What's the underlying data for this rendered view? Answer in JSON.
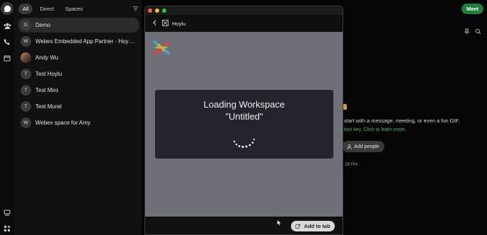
{
  "list": {
    "tabs": [
      {
        "label": "All",
        "active": true
      },
      {
        "label": "Direct",
        "active": false
      },
      {
        "label": "Spaces",
        "active": false
      }
    ],
    "conversations": [
      {
        "initial": "D",
        "label": "Demo",
        "active": true
      },
      {
        "initial": "W",
        "label": "Webex Embedded App Partner - Hoylu...",
        "active": false
      },
      {
        "initial": "",
        "label": "Andy Wu",
        "active": false,
        "photo": true
      },
      {
        "initial": "T",
        "label": "Test Hoylu",
        "active": false
      },
      {
        "initial": "T",
        "label": "Test Miro",
        "active": false
      },
      {
        "initial": "T",
        "label": "Test Mural",
        "active": false
      },
      {
        "initial": "W",
        "label": "Webex space for Amy",
        "active": false
      }
    ]
  },
  "main": {
    "meet_label": "Meet",
    "message": "start with a message, meeting, or even a fun GIF.",
    "link": "tion key. Click to learn more.",
    "add_people_label": "Add people",
    "time": ":26 PM"
  },
  "popup": {
    "title": "Hoylu",
    "loading_title": "Loading Workspace",
    "loading_name": "\"Untitled\"",
    "add_to_tab_label": "Add to tab"
  },
  "colors": {
    "canvas": "#6f6f78",
    "meet": "#1e7f3a",
    "link": "#4fb870"
  }
}
